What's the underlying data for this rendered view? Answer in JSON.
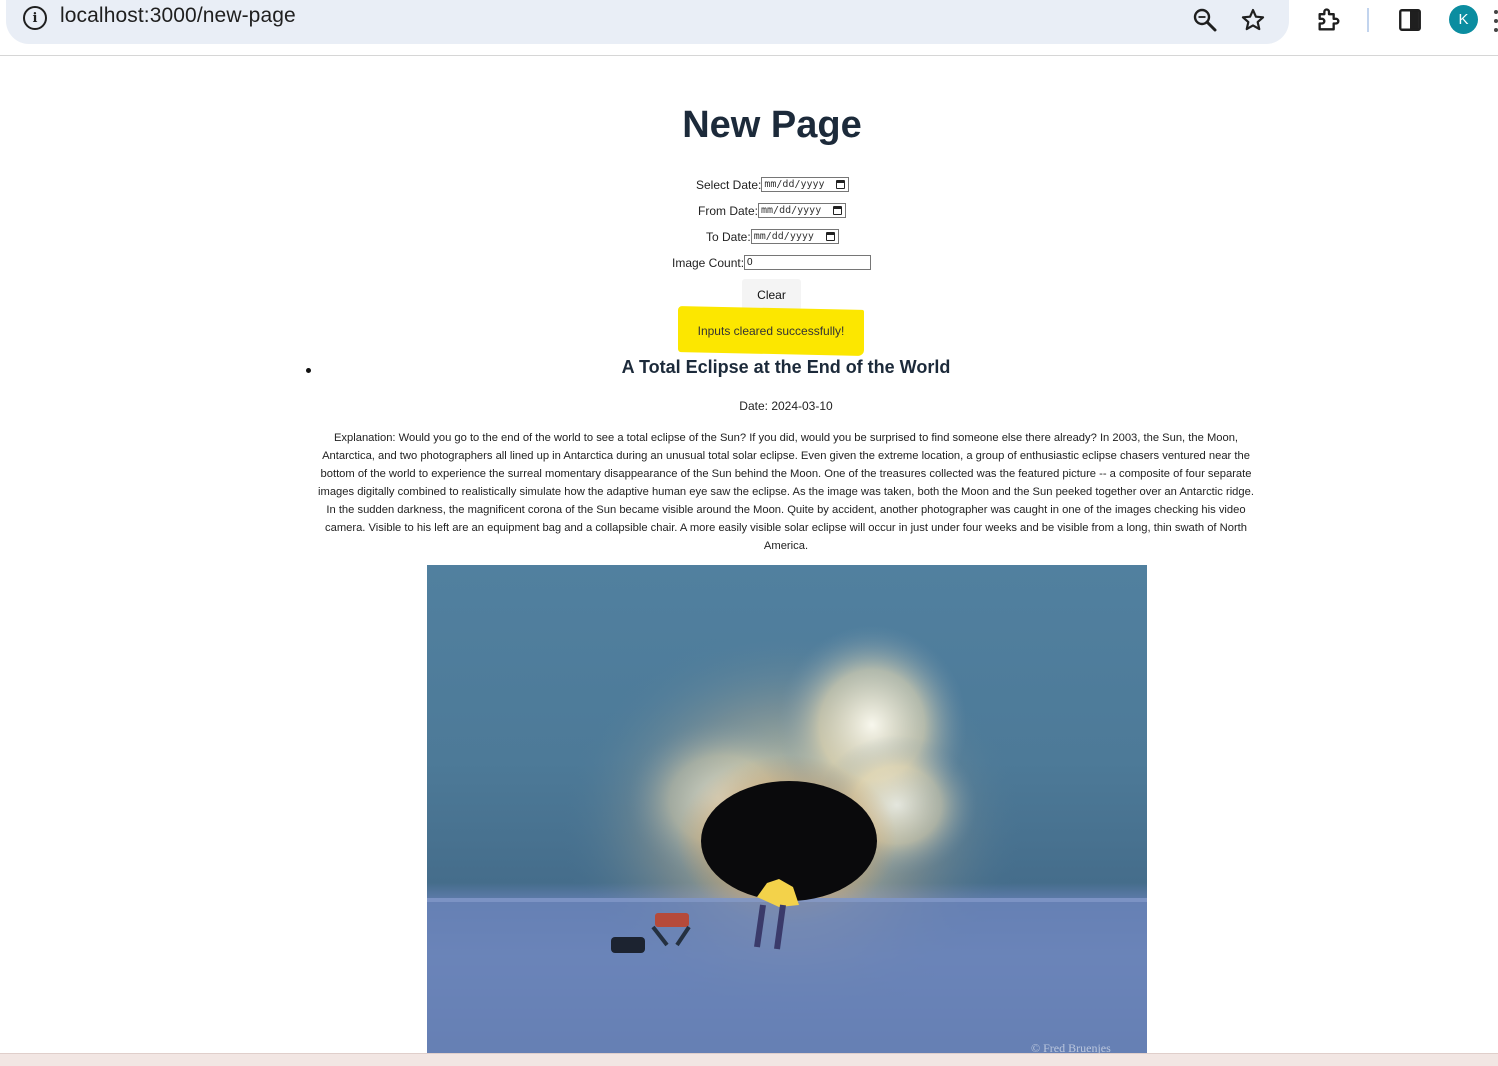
{
  "browser": {
    "url": "localhost:3000/new-page",
    "avatar_letter": "K",
    "icons": [
      "info-icon",
      "zoom-icon",
      "star-icon",
      "extensions-icon",
      "side-panel-icon",
      "menu-icon"
    ],
    "avatar_color": "#0b8da0"
  },
  "page": {
    "title": "New Page",
    "form": {
      "select_date_label": "Select Date:",
      "select_date_placeholder": "mm/dd/yyyy",
      "from_date_label": "From Date:",
      "from_date_placeholder": "mm/dd/yyyy",
      "to_date_label": "To Date:",
      "to_date_placeholder": "mm/dd/yyyy",
      "image_count_label": "Image Count:",
      "image_count_value": "0",
      "clear_label": "Clear"
    },
    "toast": {
      "message": "Inputs cleared successfully!",
      "color": "#fce700"
    },
    "article": {
      "title": "A Total Eclipse at the End of the World",
      "date": "Date: 2024-03-10",
      "explanation": "Explanation: Would you go to the end of the world to see a total eclipse of the Sun? If you did, would you be surprised to find someone else there already? In 2003, the Sun, the Moon, Antarctica, and two photographers all lined up in Antarctica during an unusual total solar eclipse. Even given the extreme location, a group of enthusiastic eclipse chasers ventured near the bottom of the world to experience the surreal momentary disappearance of the Sun behind the Moon. One of the treasures collected was the featured picture -- a composite of four separate images digitally combined to realistically simulate how the adaptive human eye saw the eclipse. As the image was taken, both the Moon and the Sun peeked together over an Antarctic ridge. In the sudden darkness, the magnificent corona of the Sun became visible around the Moon. Quite by accident, another photographer was caught in one of the images checking his video camera. Visible to his left are an equipment bag and a collapsible chair. A more easily visible solar eclipse will occur in just under four weeks and be visible from a long, thin swath of North America.",
      "image_watermark": "© Fred Bruenjes"
    }
  }
}
